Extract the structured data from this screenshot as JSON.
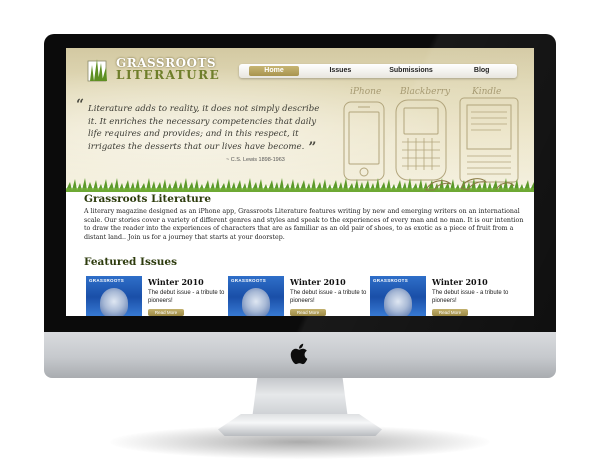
{
  "site": {
    "logo": {
      "line1": "GRASSROOTS",
      "line2": "LITERATURE"
    },
    "nav": [
      {
        "label": "Home",
        "active": true
      },
      {
        "label": "Issues",
        "active": false
      },
      {
        "label": "Submissions",
        "active": false
      },
      {
        "label": "Blog",
        "active": false
      }
    ],
    "quote": {
      "text": "Literature adds to reality, it does not simply describe it. It enriches the necessary competencies that daily life requires and provides; and in this respect, it irrigates the desserts that our lives have become.",
      "attribution": "~ C.S. Lewis 1898-1963"
    },
    "devices": [
      "iPhone",
      "Blackberry",
      "Kindle"
    ],
    "title": "Grassroots Literature",
    "intro": "A literary magazine designed as an iPhone app, Grassroots Literature features writing by new and emerging writers on an international scale. Our stories cover a variety of different genres and styles and speak to the experiences of every man and no man. It is our intention to draw the reader into the experiences of characters that are as familiar as an old pair of shoes, to as exotic as a piece of fruit from a distant land.. Join us for a journey that starts at your doorstep.",
    "featured_title": "Featured Issues",
    "issues": [
      {
        "cover_brand": "GRASSROOTS",
        "title": "Winter 2010",
        "desc": "The debut issue - a tribute to pioneers!",
        "button": "Read More"
      },
      {
        "cover_brand": "GRASSROOTS",
        "title": "Winter 2010",
        "desc": "The debut issue - a tribute to pioneers!",
        "button": "Read More"
      },
      {
        "cover_brand": "GRASSROOTS",
        "title": "Winter 2010",
        "desc": "The debut issue - a tribute to pioneers!",
        "button": "Read More"
      }
    ]
  },
  "colors": {
    "header": "#e2dab8",
    "accent": "#a8944e",
    "heading": "#2d3b0d",
    "grass": "#5c9a2a",
    "bezel": "#0b0b0b"
  },
  "icons": {
    "brand": "apple-logo-icon",
    "logo": "grass-logo-icon"
  }
}
